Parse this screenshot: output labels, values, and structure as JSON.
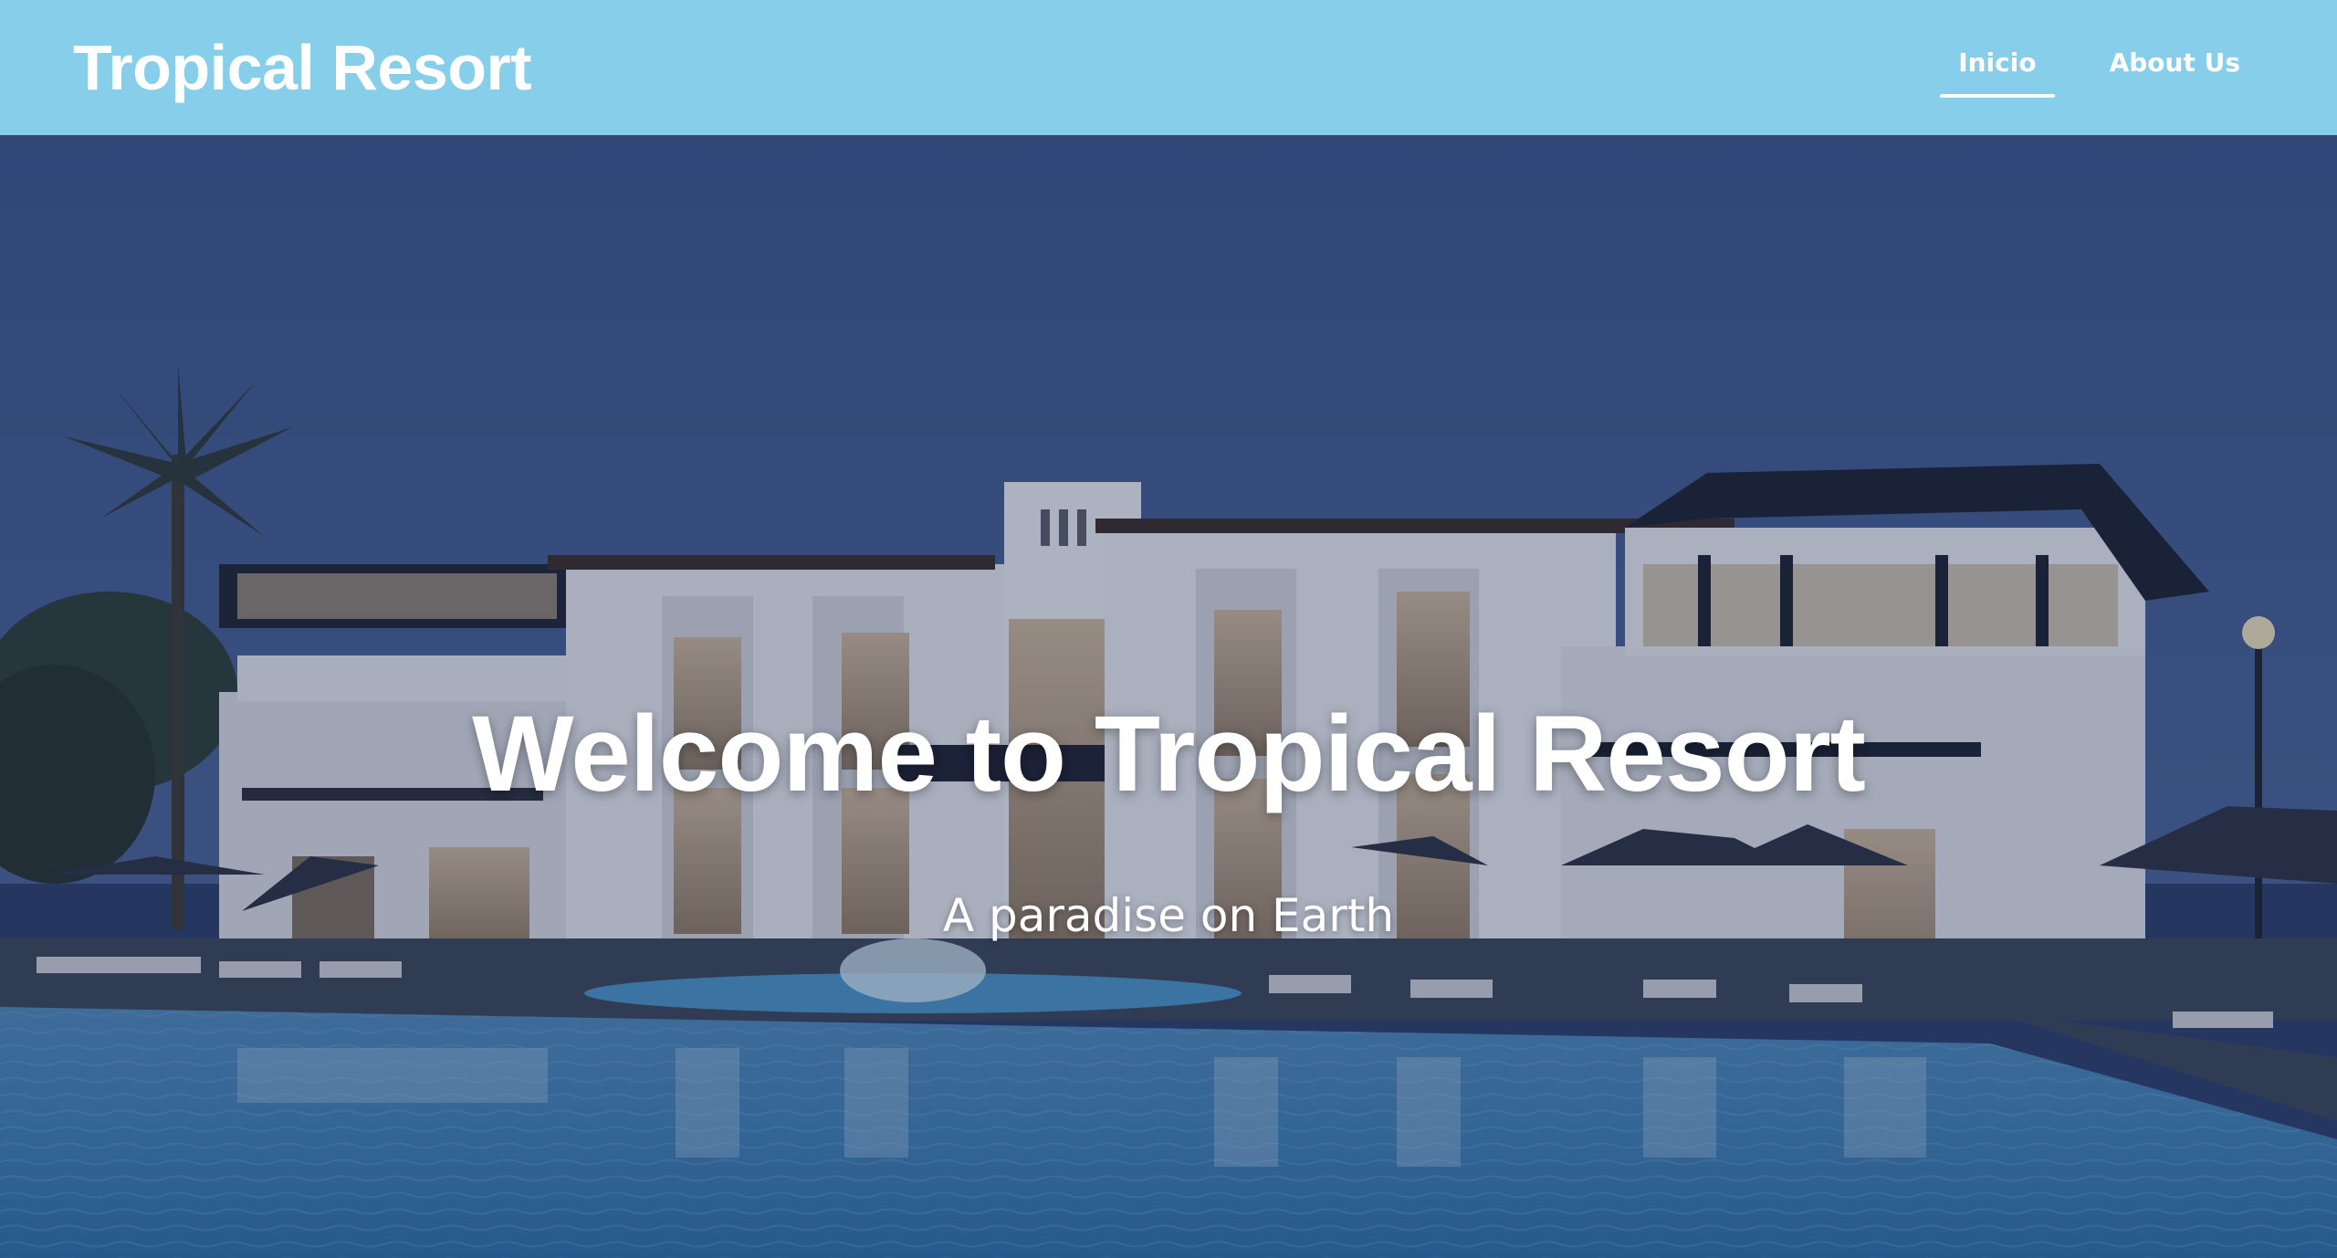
{
  "header": {
    "brand": "Tropical Resort",
    "nav": [
      {
        "label": "Inicio",
        "active": true
      },
      {
        "label": "About Us",
        "active": false
      }
    ],
    "background_color": "#87ceeb"
  },
  "hero": {
    "title": "Welcome to Tropical Resort",
    "subtitle": "A paradise on Earth",
    "background_image": "resort-with-pool-at-dusk"
  }
}
